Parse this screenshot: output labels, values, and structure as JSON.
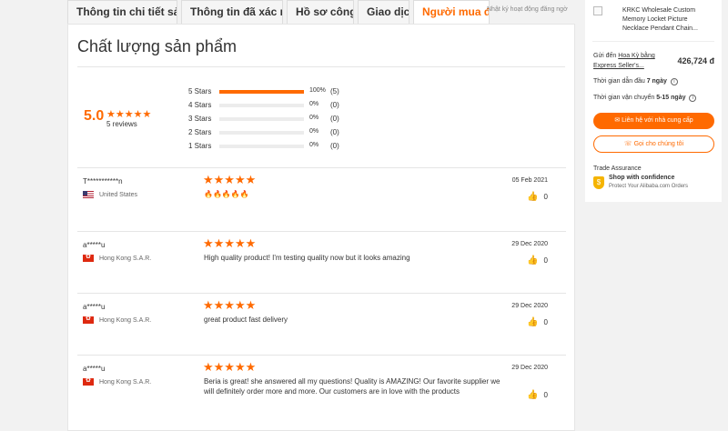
{
  "tabs": [
    {
      "label": "Thông tin chi tiết sản p..."
    },
    {
      "label": "Thông tin đã xác minh"
    },
    {
      "label": "Hồ sơ công ty"
    },
    {
      "label": "Giao dịch"
    },
    {
      "label": "Người mua đánh giá"
    }
  ],
  "tab_overlay": "Nhật ký hoạt động đăng ngờ",
  "section_title": "Chất lượng sản phẩm",
  "summary": {
    "average": "5.0",
    "stars": "★★★★★",
    "review_count": "5 reviews",
    "breakdown": [
      {
        "label": "5 Stars",
        "pct": "100%",
        "count": "(5)",
        "fill": 1.0
      },
      {
        "label": "4 Stars",
        "pct": "0%",
        "count": "(0)",
        "fill": 0
      },
      {
        "label": "3 Stars",
        "pct": "0%",
        "count": "(0)",
        "fill": 0
      },
      {
        "label": "2 Stars",
        "pct": "0%",
        "count": "(0)",
        "fill": 0
      },
      {
        "label": "1 Stars",
        "pct": "0%",
        "count": "(0)",
        "fill": 0
      }
    ]
  },
  "reviews": [
    {
      "user": "T***********n",
      "country": "United States",
      "flag": "us",
      "stars": "★★★★★",
      "text": "🔥🔥🔥🔥🔥",
      "date": "05 Feb 2021",
      "likes": "0"
    },
    {
      "user": "a*****u",
      "country": "Hong Kong S.A.R.",
      "flag": "hk",
      "stars": "★★★★★",
      "text": "High quality product! I'm testing quality now but it looks amazing",
      "date": "29 Dec 2020",
      "likes": "0"
    },
    {
      "user": "a*****u",
      "country": "Hong Kong S.A.R.",
      "flag": "hk",
      "stars": "★★★★★",
      "text": "great product fast delivery",
      "date": "29 Dec 2020",
      "likes": "0"
    },
    {
      "user": "a*****u",
      "country": "Hong Kong S.A.R.",
      "flag": "hk",
      "stars": "★★★★★",
      "text": "Beria is great! she answered all my questions!  Quality is AMAZING! Our favorite supplier we will definitely order more and more. Our customers are in love with the products",
      "date": "29 Dec 2020",
      "likes": "0"
    }
  ],
  "card": {
    "product_title": "KRKC Wholesale Custom Memory Locket Picture Necklace Pendant Chain...",
    "ship_prefix": "Gửi đến ",
    "ship_link": "Hoa Kỳ bằng Express Seller's...",
    "price": "426,724 đ",
    "lead_prefix": "Thời gian dẫn đầu ",
    "lead_value": "7 ngày",
    "transit_prefix": "Thời gian vận chuyển ",
    "transit_value": "5-15 ngày",
    "contact_button": "Liên hệ với nhà cung cấp",
    "call_button": "Gọi cho chúng tôi",
    "trade_assurance": "Trade Assurance",
    "shop_confidence": "Shop with confidence",
    "protect_text": "Protect Your Alibaba.com Orders"
  },
  "colors": {
    "accent": "#ff6a00"
  }
}
